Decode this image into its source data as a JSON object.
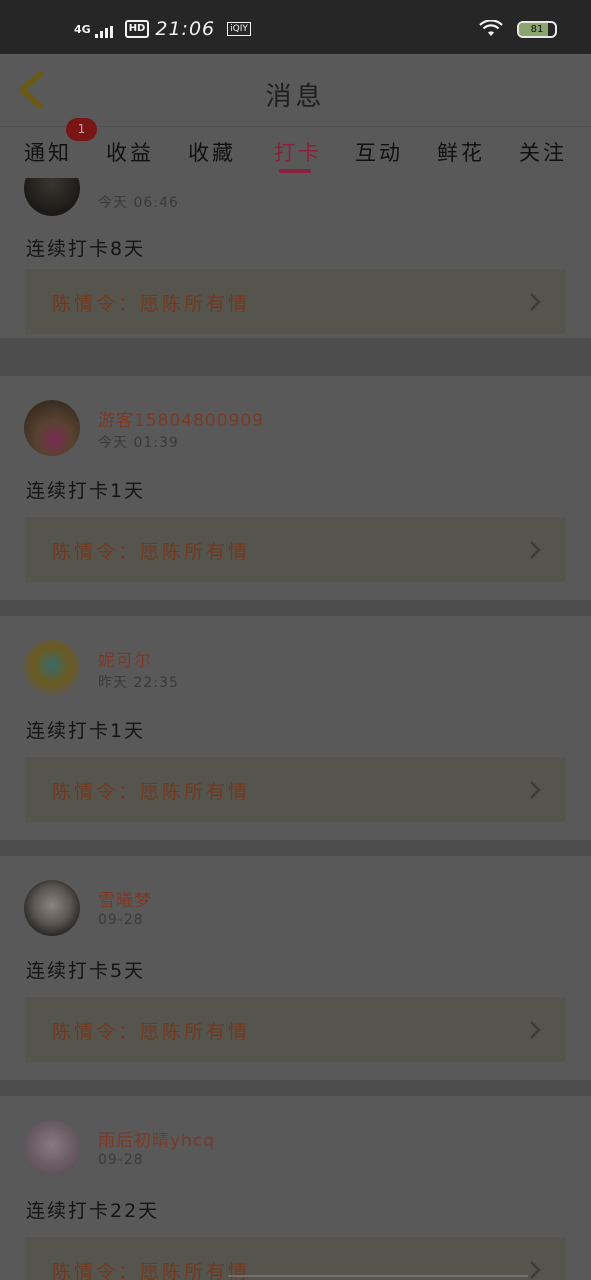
{
  "status_bar": {
    "network": "4G",
    "hd": "HD",
    "time": "21:06",
    "app_icon": "iQIY",
    "battery": "81",
    "battery_level": 0.81
  },
  "header": {
    "title": "消息",
    "back_icon": "back-arrow-icon"
  },
  "tabs": [
    {
      "label": "通知",
      "badge": "1"
    },
    {
      "label": "收益"
    },
    {
      "label": "收藏"
    },
    {
      "label": "打卡",
      "active": true
    },
    {
      "label": "互动"
    },
    {
      "label": "鲜花"
    },
    {
      "label": "关注"
    }
  ],
  "feed": [
    {
      "name": "",
      "time": "今天 06:46",
      "text": "连续打卡8天",
      "link": "陈情令：愿陈所有情"
    },
    {
      "name": "游客15804800909",
      "time": "今天 01:39",
      "text": "连续打卡1天",
      "link": "陈情令：愿陈所有情"
    },
    {
      "name": "妮可尔",
      "time": "昨天 22:35",
      "text": "连续打卡1天",
      "link": "陈情令：愿陈所有情"
    },
    {
      "name": "雪曦梦",
      "time": "09-28",
      "text": "连续打卡5天",
      "link": "陈情令：愿陈所有情"
    },
    {
      "name": "雨后初晴yhcq",
      "time": "09-28",
      "text": "连续打卡22天",
      "link": "陈情令：愿陈所有情"
    }
  ],
  "colors": {
    "accent": "#8a2040",
    "username": "#7a3a28",
    "badge": "#7a1515"
  }
}
